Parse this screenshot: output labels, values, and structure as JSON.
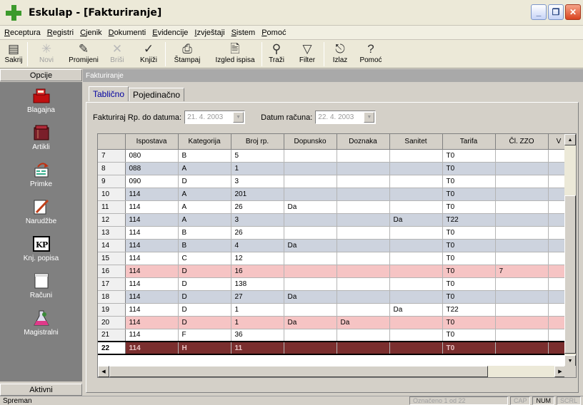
{
  "window": {
    "title": "Eskulap - [Fakturiranje]"
  },
  "menu": [
    "Receptura",
    "Registri",
    "Cjenik",
    "Dokumenti",
    "Evidencije",
    "Izvještaji",
    "Sistem",
    "Pomoć"
  ],
  "toolbar": {
    "sakrij": "Sakrij",
    "novi": "Novi",
    "promijeni": "Promijeni",
    "brisi": "Briši",
    "knjizi": "Knjiži",
    "stampaj": "Štampaj",
    "izgled": "Izgled ispisa",
    "trazi": "Traži",
    "filter": "Filter",
    "izlaz": "Izlaz",
    "pomoc": "Pomoć"
  },
  "sidebar": {
    "header": "Opcije",
    "footer": "Aktivni",
    "items": [
      {
        "label": "Blagajna",
        "icon": "cash-register-icon"
      },
      {
        "label": "Artikli",
        "icon": "box-icon"
      },
      {
        "label": "Primke",
        "icon": "receipt-icon"
      },
      {
        "label": "Narudžbe",
        "icon": "order-pencil-icon"
      },
      {
        "label": "Knj. popisa",
        "icon": "kp-book-icon"
      },
      {
        "label": "Računi",
        "icon": "invoice-icon"
      },
      {
        "label": "Magistralni",
        "icon": "flask-icon"
      }
    ]
  },
  "document": {
    "header": "Fakturiranje",
    "tabs": [
      "Tablično",
      "Pojedinačno"
    ],
    "filter_label": "Fakturiraj Rp. do datuma:",
    "filter_date": "21. 4. 2003",
    "datum_label": "Datum računa:",
    "datum_value": "22. 4. 2003"
  },
  "grid": {
    "columns": [
      "",
      "Ispostava",
      "Kategorija",
      "Broj rp.",
      "Dopunsko",
      "Doznaka",
      "Sanitet",
      "Tarifa",
      "Čl. ZZO",
      "V"
    ],
    "rows": [
      {
        "n": "7",
        "ispostava": "080",
        "kategorija": "B",
        "broj": "5",
        "dopunsko": "",
        "doznaka": "",
        "sanitet": "",
        "tarifa": "T0",
        "zzo": "",
        "style": "plain"
      },
      {
        "n": "8",
        "ispostava": "088",
        "kategorija": "A",
        "broj": "1",
        "dopunsko": "",
        "doznaka": "",
        "sanitet": "",
        "tarifa": "T0",
        "zzo": "",
        "style": "alt"
      },
      {
        "n": "9",
        "ispostava": "090",
        "kategorija": "D",
        "broj": "3",
        "dopunsko": "",
        "doznaka": "",
        "sanitet": "",
        "tarifa": "T0",
        "zzo": "",
        "style": "plain"
      },
      {
        "n": "10",
        "ispostava": "114",
        "kategorija": "A",
        "broj": "201",
        "dopunsko": "",
        "doznaka": "",
        "sanitet": "",
        "tarifa": "T0",
        "zzo": "",
        "style": "alt"
      },
      {
        "n": "11",
        "ispostava": "114",
        "kategorija": "A",
        "broj": "26",
        "dopunsko": "Da",
        "doznaka": "",
        "sanitet": "",
        "tarifa": "T0",
        "zzo": "",
        "style": "plain"
      },
      {
        "n": "12",
        "ispostava": "114",
        "kategorija": "A",
        "broj": "3",
        "dopunsko": "",
        "doznaka": "",
        "sanitet": "Da",
        "tarifa": "T22",
        "zzo": "",
        "style": "alt"
      },
      {
        "n": "13",
        "ispostava": "114",
        "kategorija": "B",
        "broj": "26",
        "dopunsko": "",
        "doznaka": "",
        "sanitet": "",
        "tarifa": "T0",
        "zzo": "",
        "style": "plain"
      },
      {
        "n": "14",
        "ispostava": "114",
        "kategorija": "B",
        "broj": "4",
        "dopunsko": "Da",
        "doznaka": "",
        "sanitet": "",
        "tarifa": "T0",
        "zzo": "",
        "style": "alt"
      },
      {
        "n": "15",
        "ispostava": "114",
        "kategorija": "C",
        "broj": "12",
        "dopunsko": "",
        "doznaka": "",
        "sanitet": "",
        "tarifa": "T0",
        "zzo": "",
        "style": "plain"
      },
      {
        "n": "16",
        "ispostava": "114",
        "kategorija": "D",
        "broj": "16",
        "dopunsko": "",
        "doznaka": "",
        "sanitet": "",
        "tarifa": "T0",
        "zzo": "7",
        "style": "hl"
      },
      {
        "n": "17",
        "ispostava": "114",
        "kategorija": "D",
        "broj": "138",
        "dopunsko": "",
        "doznaka": "",
        "sanitet": "",
        "tarifa": "T0",
        "zzo": "",
        "style": "plain"
      },
      {
        "n": "18",
        "ispostava": "114",
        "kategorija": "D",
        "broj": "27",
        "dopunsko": "Da",
        "doznaka": "",
        "sanitet": "",
        "tarifa": "T0",
        "zzo": "",
        "style": "alt"
      },
      {
        "n": "19",
        "ispostava": "114",
        "kategorija": "D",
        "broj": "1",
        "dopunsko": "",
        "doznaka": "",
        "sanitet": "Da",
        "tarifa": "T22",
        "zzo": "",
        "style": "plain"
      },
      {
        "n": "20",
        "ispostava": "114",
        "kategorija": "D",
        "broj": "1",
        "dopunsko": "Da",
        "doznaka": "Da",
        "sanitet": "",
        "tarifa": "T0",
        "zzo": "",
        "style": "hl"
      },
      {
        "n": "21",
        "ispostava": "114",
        "kategorija": "F",
        "broj": "36",
        "dopunsko": "",
        "doznaka": "",
        "sanitet": "",
        "tarifa": "T0",
        "zzo": "",
        "style": "plain"
      },
      {
        "n": "22",
        "ispostava": "114",
        "kategorija": "H",
        "broj": "11",
        "dopunsko": "",
        "doznaka": "",
        "sanitet": "",
        "tarifa": "T0",
        "zzo": "",
        "style": "sel"
      }
    ]
  },
  "status": {
    "left": "Spreman",
    "count": "Označeno 1 od 22",
    "cap": "CAP",
    "num": "NUM",
    "scrl": "SCRL"
  }
}
